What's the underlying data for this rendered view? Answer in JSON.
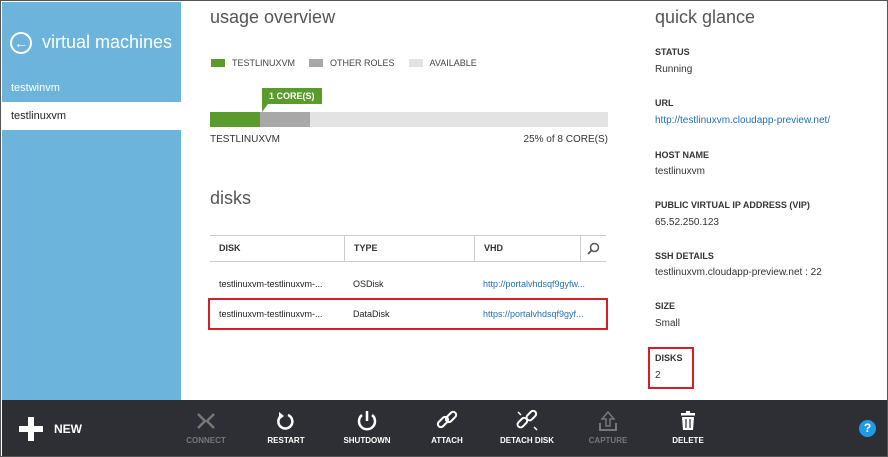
{
  "sidebar": {
    "title": "virtual machines",
    "items": [
      {
        "label": "testwinvm"
      },
      {
        "label": "testlinuxvm"
      }
    ]
  },
  "usage": {
    "title": "usage overview",
    "legend": [
      {
        "label": "TESTLINUXVM",
        "color": "#5a9c2c"
      },
      {
        "label": "OTHER ROLES",
        "color": "#a8a8a8"
      },
      {
        "label": "AVAILABLE",
        "color": "#e3e3e3"
      }
    ],
    "badge": "1 CORE(S)",
    "bar_label": "TESTLINUXVM",
    "summary": "25% of 8 CORE(S)",
    "fractions": {
      "testlinuxvm": 0.125,
      "other_roles": 0.125
    }
  },
  "disks": {
    "title": "disks",
    "columns": [
      "DISK",
      "TYPE",
      "VHD"
    ],
    "rows": [
      {
        "disk": "testlinuxvm-testlinuxvm-...",
        "type": "OSDisk",
        "vhd": "http://portalvhdsqf9gyfw..."
      },
      {
        "disk": "testlinuxvm-testlinuxvm-...",
        "type": "DataDisk",
        "vhd": "https://portalvhdsqf9gyf..."
      }
    ]
  },
  "quick": {
    "title": "quick glance",
    "status_label": "STATUS",
    "status": "Running",
    "url_label": "URL",
    "url": "http://testlinuxvm.cloudapp-preview.net/",
    "host_label": "HOST NAME",
    "host": "testlinuxvm",
    "vip_label": "PUBLIC VIRTUAL IP ADDRESS (VIP)",
    "vip": "65.52.250.123",
    "ssh_label": "SSH DETAILS",
    "ssh": "testlinuxvm.cloudapp-preview.net : 22",
    "size_label": "SIZE",
    "size": "Small",
    "disks_label": "DISKS",
    "disks": "2"
  },
  "commands": {
    "new": "NEW",
    "connect": "CONNECT",
    "restart": "RESTART",
    "shutdown": "SHUTDOWN",
    "attach": "ATTACH",
    "detach": "DETACH DISK",
    "capture": "CAPTURE",
    "delete": "DELETE",
    "help": "?"
  }
}
